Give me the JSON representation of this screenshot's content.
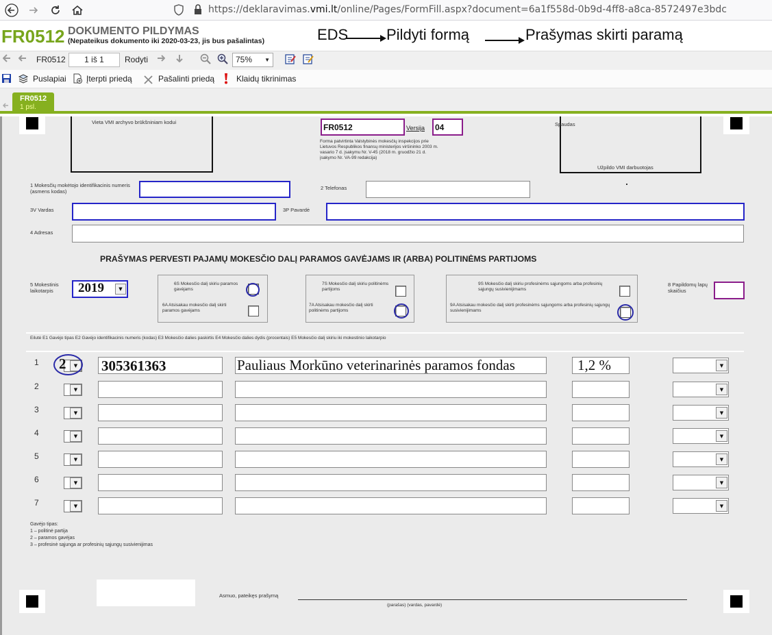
{
  "browser": {
    "url_prefix": "https://deklaravimas.",
    "url_host": "vmi.lt",
    "url_rest": "/online/Pages/FormFill.aspx?document=6a1f558d-0b9d-4ff8-a8ca-8572497e3bdc"
  },
  "header": {
    "code": "FR0512",
    "title": "DOKUMENTO PILDYMAS",
    "subtitle": "(Nepateikus dokumento iki 2020-03-23, jis bus pašalintas)",
    "annotation": {
      "step1": "EDS",
      "step2": "Pildyti formą",
      "step3": "Prašymas skirti paramą"
    }
  },
  "toolbar1": {
    "doc_code": "FR0512",
    "page_indicator": "1 iš 1",
    "show_label": "Rodyti",
    "zoom": "75%"
  },
  "toolbar2": {
    "pages": "Puslapiai",
    "insert_attachment": "Įterpti priedą",
    "remove_attachment": "Pašalinti priedą",
    "error_check": "Klaidų tikrinimas"
  },
  "tab": {
    "label": "FR0512",
    "sub": "1 psl."
  },
  "form": {
    "archive_box_label": "Vieta VMI archyvo brūkšniniam kodui",
    "form_code": "FR0512",
    "version_label": "Versija",
    "version": "04",
    "approval_text": "Forma patvirtinta Valstybinės mokesčių inspekcijos prie Lietuvos Respublikos finansų ministerijos viršininko 2003 m. vasario 7 d. įsakymu Nr. V-45 (2018 m. gruodžio 21 d. įsakymo Nr. VA-99 redakcija)",
    "stamp_box_label": "Spaudas",
    "stamp_box_footer": "Užpildo VMI darbuotojas",
    "field1_label": "1 Mokesčių mokėtojo identifikacinis numeris (asmens kodas)",
    "field2_label": "2 Telefonas",
    "field3v_label": "3V Vardas",
    "field3p_label": "3P Pavardė",
    "field4_label": "4 Adresas",
    "main_title": "PRAŠYMAS PERVESTI PAJAMŲ MOKESČIO DALĮ PARAMOS GAVĖJAMS IR (ARBA) POLITINĖMS PARTIJOMS",
    "field5_label": "5 Mokestinis laikotarpis",
    "year": "2019",
    "opt6s": "6S Mokesčio dalį skiriu paramos gavėjams",
    "opt6a": "6A Atsisakau mokesčio dalį skirti paramos gavėjams",
    "opt7s": "7S Mokesčio dalį skiriu politinėms partijoms",
    "opt7a": "7A Atsisakau mokesčio dalį skirti politinėms partijoms",
    "opt9s": "9S Mokesčio dalį skiriu profesinėms sąjungoms arba profesinių sąjungų susivienijimams",
    "opt9a": "9A Atsisakau mokesčio dalį skirti profesinėms sąjungoms arba profesinių sąjungų susivienijimams",
    "field8_label": "8 Papildomų lapų skaičius",
    "table_header": "Eilutė E1 Gavėjo tipas E2 Gavėjo identifikacinis numeris (kodas) E3 Mokesčio dalies paskirtis E4 Mokesčio dalies dydis (procentais) E5 Mokesčio dalį skiriu iki mokestinio laikotarpio",
    "rows": [
      {
        "num": "1",
        "type": "2",
        "code": "305361363",
        "purpose": "Pauliaus Morkūno veterinarinės paramos fondas",
        "percent": "1,2 %"
      },
      {
        "num": "2",
        "type": "",
        "code": "",
        "purpose": "",
        "percent": ""
      },
      {
        "num": "3",
        "type": "",
        "code": "",
        "purpose": "",
        "percent": ""
      },
      {
        "num": "4",
        "type": "",
        "code": "",
        "purpose": "",
        "percent": ""
      },
      {
        "num": "5",
        "type": "",
        "code": "",
        "purpose": "",
        "percent": ""
      },
      {
        "num": "6",
        "type": "",
        "code": "",
        "purpose": "",
        "percent": ""
      },
      {
        "num": "7",
        "type": "",
        "code": "",
        "purpose": "",
        "percent": ""
      }
    ],
    "legend_title": "Gavėjo tipas:",
    "legend_1": "1 – politinė partija",
    "legend_2": "2 – paramos gavėjas",
    "legend_3": "3 – profesinė sąjunga ar profesinių sąjungų susivienijimas",
    "signer_label": "Asmuo, pateikęs prašymą",
    "signature_caption": "(parašas) (vardas, pavardė)"
  }
}
